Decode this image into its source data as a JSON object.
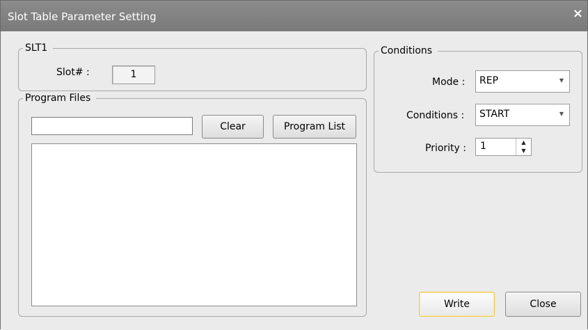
{
  "window": {
    "title": "Slot Table Parameter Setting",
    "close_glyph": "×"
  },
  "slt_group": {
    "legend": "SLT1",
    "slot_label": "Slot# :",
    "slot_value": "1"
  },
  "program_files": {
    "legend": "Program Files",
    "input_value": "",
    "clear_label": "Clear",
    "program_list_label": "Program List",
    "files": []
  },
  "conditions": {
    "legend": "Conditions",
    "mode_label": "Mode :",
    "mode_value": "REP",
    "conditions_label": "Conditions :",
    "conditions_value": "START",
    "priority_label": "Priority :",
    "priority_value": "1"
  },
  "footer": {
    "write_label": "Write",
    "close_label": "Close"
  },
  "icons": {
    "dropdown": "chevron-down-icon",
    "spin_up": "spin-up-icon",
    "spin_down": "spin-down-icon",
    "close": "close-icon"
  }
}
